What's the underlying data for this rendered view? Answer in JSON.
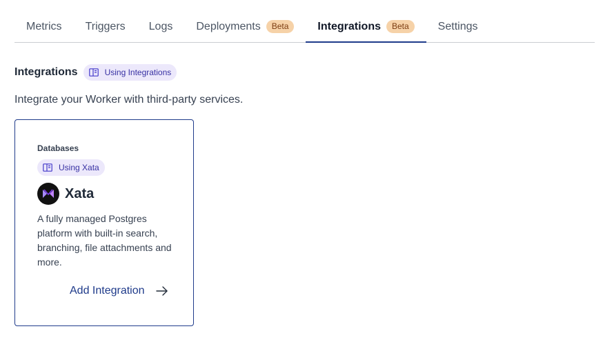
{
  "tabs": [
    {
      "label": "Metrics",
      "active": false
    },
    {
      "label": "Triggers",
      "active": false
    },
    {
      "label": "Logs",
      "active": false
    },
    {
      "label": "Deployments",
      "badge": "Beta",
      "active": false
    },
    {
      "label": "Integrations",
      "badge": "Beta",
      "active": true
    },
    {
      "label": "Settings",
      "active": false
    }
  ],
  "section": {
    "title": "Integrations",
    "doc_link": "Using Integrations",
    "description": "Integrate your Worker with third-party services."
  },
  "card": {
    "category": "Databases",
    "doc_link": "Using Xata",
    "name": "Xata",
    "description": "A fully managed Postgres platform with built-in search, branching, file attachments and more.",
    "action": "Add Integration",
    "logo_icon": "xata-logo-icon",
    "action_icon": "arrow-right-icon"
  },
  "colors": {
    "accent": "#1e3a8a",
    "badge_bg": "#f6d2a8",
    "chip_bg": "#ece8fb",
    "chip_text": "#3730a3"
  }
}
